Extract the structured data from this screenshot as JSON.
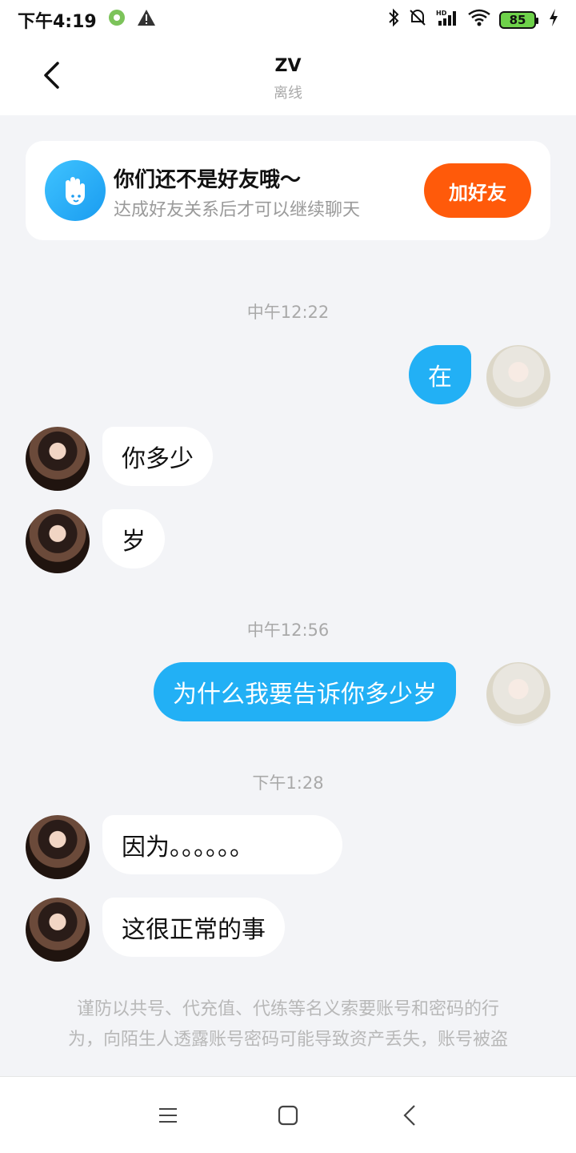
{
  "status_bar": {
    "time": "下午4:19",
    "battery": "85",
    "icons": [
      "app-settings-icon",
      "warning-icon",
      "bluetooth-icon",
      "mute-alarm-icon",
      "hd-signal-icon",
      "wifi-icon",
      "battery-icon",
      "charging-icon"
    ]
  },
  "header": {
    "title": "ZV",
    "status": "离线",
    "back_icon": "back-icon"
  },
  "friend_card": {
    "title": "你们还不是好友哦～",
    "subtitle": "达成好友关系后才可以继续聊天",
    "button": "加好友",
    "icon": "hand-wave-icon",
    "accent": "#ff5a0a"
  },
  "messages": {
    "ts1": "中午12:22",
    "m1": "在",
    "m2": "你多少",
    "m3": "岁",
    "ts2": "中午12:56",
    "m4": "为什么我要告诉你多少岁",
    "ts3": "下午1:28",
    "m5": "因为。。。。。。",
    "m6": "这很正常的事"
  },
  "disclaimer": {
    "line1": "谨防以共号、代充值、代练等名义索要账号和密码的行",
    "line2": "为，向陌生人透露账号密码可能导致资产丢失，账号被盗"
  },
  "colors": {
    "self_bubble": "#22b0f5",
    "other_bubble": "#ffffff",
    "background": "#f3f4f7"
  },
  "nav_bar": {
    "icons": [
      "menu-icon",
      "home-icon",
      "back-nav-icon"
    ]
  }
}
